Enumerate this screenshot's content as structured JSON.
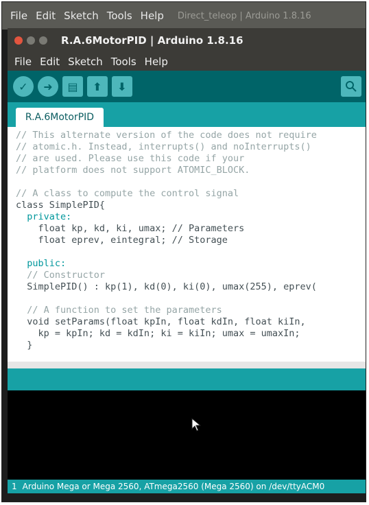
{
  "background_window": {
    "menu": [
      "File",
      "Edit",
      "Sketch",
      "Tools",
      "Help"
    ],
    "title": "Direct_teleop | Arduino 1.8.16"
  },
  "window": {
    "title": "R.A.6MotorPID | Arduino 1.8.16"
  },
  "menubar": {
    "items": [
      {
        "label": "File"
      },
      {
        "label": "Edit"
      },
      {
        "label": "Sketch"
      },
      {
        "label": "Tools"
      },
      {
        "label": "Help"
      }
    ]
  },
  "toolbar": {
    "buttons": [
      {
        "icon": "verify-icon",
        "glyph": "✓"
      },
      {
        "icon": "upload-icon",
        "glyph": "➜"
      },
      {
        "icon": "new-icon",
        "glyph": "▤"
      },
      {
        "icon": "open-icon",
        "glyph": "⬆"
      },
      {
        "icon": "save-icon",
        "glyph": "⬇"
      }
    ],
    "serial_monitor_icon": "serial-monitor-icon"
  },
  "tabs": [
    {
      "label": "R.A.6MotorPID"
    }
  ],
  "code": [
    {
      "text": "// This alternate version of the code does not require",
      "kind": "comment"
    },
    {
      "text": "// atomic.h. Instead, interrupts() and noInterrupts()",
      "kind": "comment"
    },
    {
      "text": "// are used. Please use this code if your",
      "kind": "comment"
    },
    {
      "text": "// platform does not support ATOMIC_BLOCK.",
      "kind": "comment"
    },
    {
      "text": "",
      "kind": "plain"
    },
    {
      "text": "// A class to compute the control signal",
      "kind": "comment"
    },
    {
      "text": "class SimplePID{",
      "kind": "plain"
    },
    {
      "text": "  private:",
      "kind": "keyword"
    },
    {
      "text": "    float kp, kd, ki, umax; // Parameters",
      "kind": "plain"
    },
    {
      "text": "    float eprev, eintegral; // Storage",
      "kind": "plain"
    },
    {
      "text": "",
      "kind": "plain"
    },
    {
      "text": "  public:",
      "kind": "keyword"
    },
    {
      "text": "  // Constructor",
      "kind": "comment"
    },
    {
      "text": "  SimplePID() : kp(1), kd(0), ki(0), umax(255), eprev(",
      "kind": "plain"
    },
    {
      "text": "",
      "kind": "plain"
    },
    {
      "text": "  // A function to set the parameters",
      "kind": "comment"
    },
    {
      "text": "  void setParams(float kpIn, float kdIn, float kiIn, ",
      "kind": "plain"
    },
    {
      "text": "    kp = kpIn; kd = kdIn; ki = kiIn; umax = umaxIn;",
      "kind": "plain"
    },
    {
      "text": "  }",
      "kind": "plain"
    }
  ],
  "status": {
    "line_number": "1",
    "board": "Arduino Mega or Mega 2560, ATmega2560 (Mega 2560) on /dev/ttyACM0"
  },
  "colors": {
    "teal": "#17a1a5",
    "dark_teal": "#006468",
    "comment": "#95a5a6",
    "keyword": "#00979c"
  }
}
